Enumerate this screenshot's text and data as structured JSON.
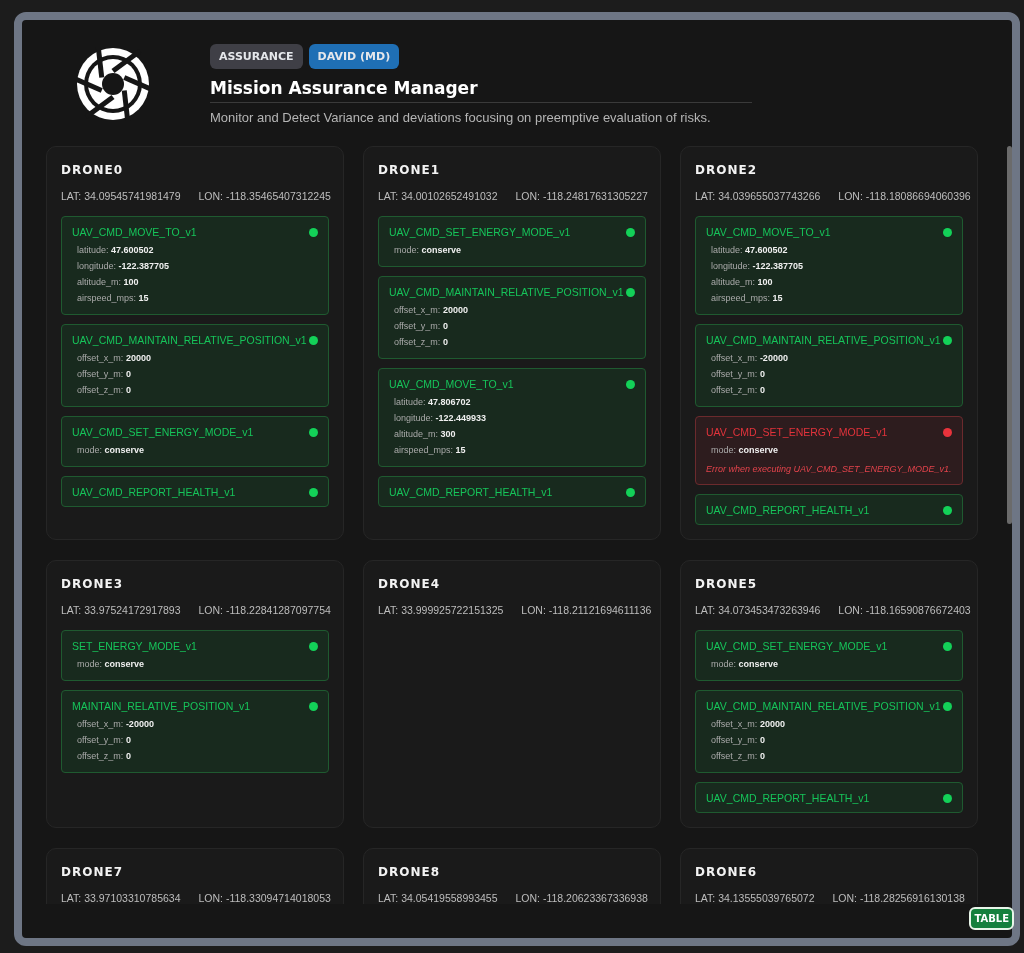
{
  "header": {
    "badges": [
      {
        "label": "ASSURANCE",
        "kind": "role"
      },
      {
        "label": "DAVID (MD)",
        "kind": "user"
      }
    ],
    "title": "Mission Assurance Manager",
    "subtitle": "Monitor and Detect Variance and deviations focusing on preemptive evaluation of risks."
  },
  "drones": [
    {
      "name": "DRONE0",
      "lat": "LAT: 34.09545741981479",
      "lon": "LON: -118.35465407312245",
      "commands": [
        {
          "name": "UAV_CMD_MOVE_TO_v1",
          "failed": false,
          "params": [
            {
              "key": "latitude:",
              "value": "47.600502"
            },
            {
              "key": "longitude:",
              "value": "-122.387705"
            },
            {
              "key": "altitude_m:",
              "value": "100"
            },
            {
              "key": "airspeed_mps:",
              "value": "15"
            }
          ]
        },
        {
          "name": "UAV_CMD_MAINTAIN_RELATIVE_POSITION_v1",
          "failed": false,
          "params": [
            {
              "key": "offset_x_m:",
              "value": "20000"
            },
            {
              "key": "offset_y_m:",
              "value": "0"
            },
            {
              "key": "offset_z_m:",
              "value": "0"
            }
          ]
        },
        {
          "name": "UAV_CMD_SET_ENERGY_MODE_v1",
          "failed": false,
          "params": [
            {
              "key": "mode:",
              "value": "conserve"
            }
          ]
        },
        {
          "name": "UAV_CMD_REPORT_HEALTH_v1",
          "failed": false
        }
      ]
    },
    {
      "name": "DRONE1",
      "lat": "LAT: 34.00102652491032",
      "lon": "LON: -118.24817631305227",
      "commands": [
        {
          "name": "UAV_CMD_SET_ENERGY_MODE_v1",
          "failed": false,
          "params": [
            {
              "key": "mode:",
              "value": "conserve"
            }
          ]
        },
        {
          "name": "UAV_CMD_MAINTAIN_RELATIVE_POSITION_v1",
          "failed": false,
          "params": [
            {
              "key": "offset_x_m:",
              "value": "20000"
            },
            {
              "key": "offset_y_m:",
              "value": "0"
            },
            {
              "key": "offset_z_m:",
              "value": "0"
            }
          ]
        },
        {
          "name": "UAV_CMD_MOVE_TO_v1",
          "failed": false,
          "params": [
            {
              "key": "latitude:",
              "value": "47.806702"
            },
            {
              "key": "longitude:",
              "value": "-122.449933"
            },
            {
              "key": "altitude_m:",
              "value": "300"
            },
            {
              "key": "airspeed_mps:",
              "value": "15"
            }
          ]
        },
        {
          "name": "UAV_CMD_REPORT_HEALTH_v1",
          "failed": false
        }
      ]
    },
    {
      "name": "DRONE2",
      "lat": "LAT: 34.039655037743266",
      "lon": "LON: -118.18086694060396",
      "commands": [
        {
          "name": "UAV_CMD_MOVE_TO_v1",
          "failed": false,
          "params": [
            {
              "key": "latitude:",
              "value": "47.600502"
            },
            {
              "key": "longitude:",
              "value": "-122.387705"
            },
            {
              "key": "altitude_m:",
              "value": "100"
            },
            {
              "key": "airspeed_mps:",
              "value": "15"
            }
          ]
        },
        {
          "name": "UAV_CMD_MAINTAIN_RELATIVE_POSITION_v1",
          "failed": false,
          "params": [
            {
              "key": "offset_x_m:",
              "value": "-20000"
            },
            {
              "key": "offset_y_m:",
              "value": "0"
            },
            {
              "key": "offset_z_m:",
              "value": "0"
            }
          ]
        },
        {
          "name": "UAV_CMD_SET_ENERGY_MODE_v1",
          "failed": true,
          "params": [
            {
              "key": "mode:",
              "value": "conserve"
            }
          ],
          "error": "Error when executing UAV_CMD_SET_ENERGY_MODE_v1."
        },
        {
          "name": "UAV_CMD_REPORT_HEALTH_v1",
          "failed": false
        }
      ]
    },
    {
      "name": "DRONE3",
      "lat": "LAT: 33.97524172917893",
      "lon": "LON: -118.22841287097754",
      "commands": [
        {
          "name": "SET_ENERGY_MODE_v1",
          "failed": false,
          "params": [
            {
              "key": "mode:",
              "value": "conserve"
            }
          ]
        },
        {
          "name": "MAINTAIN_RELATIVE_POSITION_v1",
          "failed": false,
          "params": [
            {
              "key": "offset_x_m:",
              "value": "-20000"
            },
            {
              "key": "offset_y_m:",
              "value": "0"
            },
            {
              "key": "offset_z_m:",
              "value": "0"
            }
          ]
        }
      ]
    },
    {
      "name": "DRONE4",
      "lat": "LAT: 33.999925722151325",
      "lon": "LON: -118.21121694611136"
    },
    {
      "name": "DRONE5",
      "lat": "LAT: 34.073453473263946",
      "lon": "LON: -118.16590876672403",
      "commands": [
        {
          "name": "UAV_CMD_SET_ENERGY_MODE_v1",
          "failed": false,
          "params": [
            {
              "key": "mode:",
              "value": "conserve"
            }
          ]
        },
        {
          "name": "UAV_CMD_MAINTAIN_RELATIVE_POSITION_v1",
          "failed": false,
          "params": [
            {
              "key": "offset_x_m:",
              "value": "20000"
            },
            {
              "key": "offset_y_m:",
              "value": "0"
            },
            {
              "key": "offset_z_m:",
              "value": "0"
            }
          ]
        },
        {
          "name": "UAV_CMD_REPORT_HEALTH_v1",
          "failed": false
        }
      ]
    },
    {
      "name": "DRONE7",
      "lat": "LAT: 33.97103310785634",
      "lon": "LON: -118.33094714018053"
    },
    {
      "name": "DRONE8",
      "lat": "LAT: 34.05419558993455",
      "lon": "LON: -118.20623367336938"
    },
    {
      "name": "DRONE6",
      "lat": "LAT: 34.13555039765072",
      "lon": "LON: -118.28256916130138"
    }
  ],
  "table_button": "TABLE"
}
